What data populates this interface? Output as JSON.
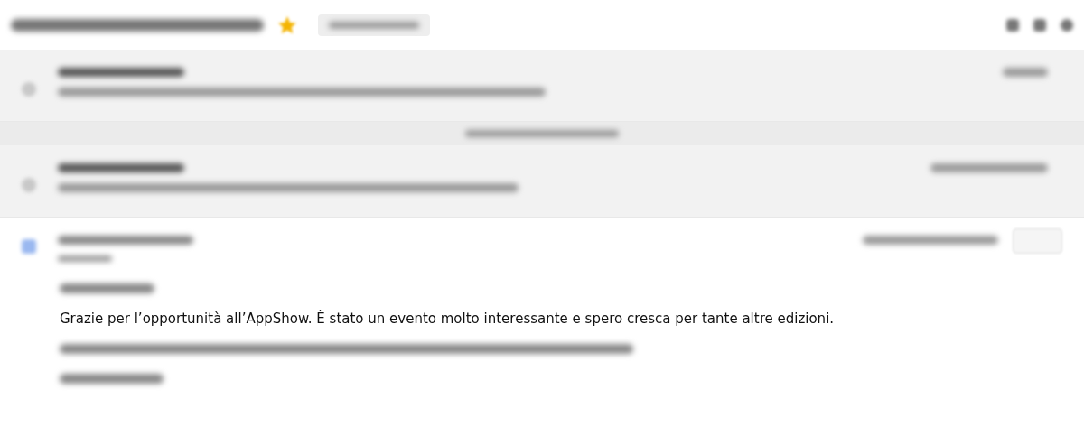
{
  "thread": {
    "starred": true
  },
  "message": {
    "body_line": "Grazie per l’opportunità all’AppShow. È stato un evento molto interessante e spero cresca per tante altre edizioni."
  }
}
